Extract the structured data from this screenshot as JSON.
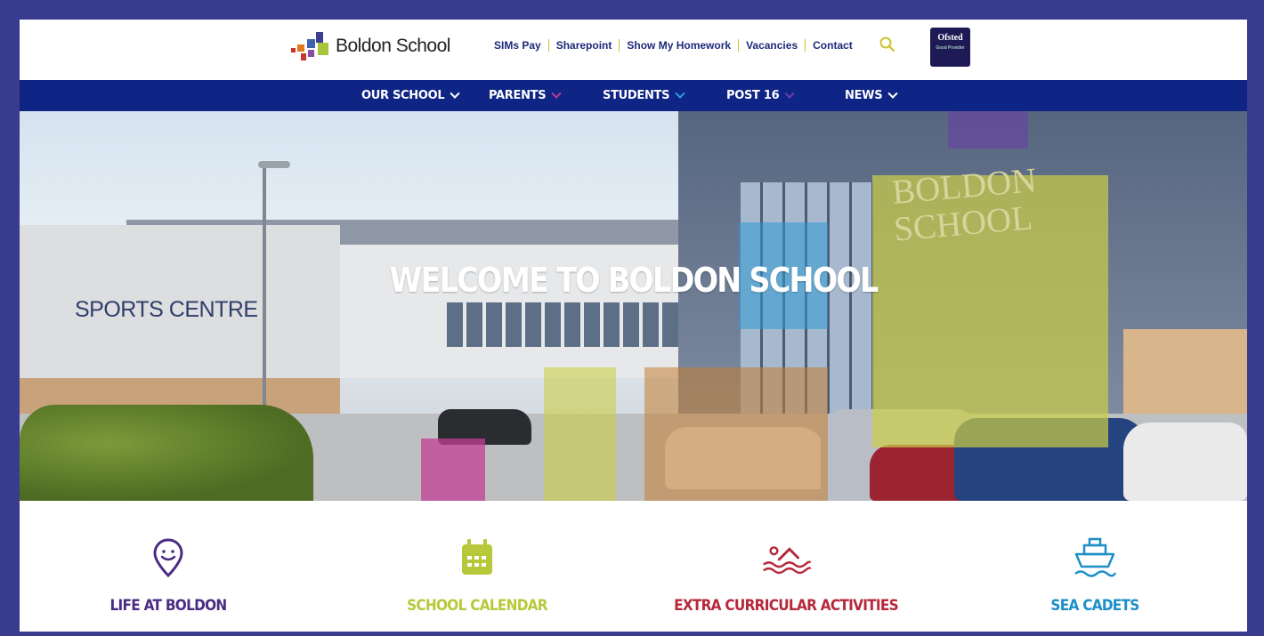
{
  "header": {
    "logo_text": "Boldon School",
    "links": [
      {
        "label": "SIMs Pay"
      },
      {
        "label": "Sharepoint"
      },
      {
        "label": "Show My Homework"
      },
      {
        "label": "Vacancies"
      },
      {
        "label": "Contact"
      }
    ],
    "search_icon": "search-icon",
    "ofsted_badge": {
      "title": "Ofsted",
      "rating": "Good Provider"
    }
  },
  "nav": {
    "items": [
      {
        "label": "OUR SCHOOL",
        "chevron_color": "#ffffff"
      },
      {
        "label": "PARENTS",
        "chevron_color": "#ba3b8f"
      },
      {
        "label": "STUDENTS",
        "chevron_color": "#2e9bd6"
      },
      {
        "label": "POST 16",
        "chevron_color": "#6a3fa6"
      },
      {
        "label": "NEWS",
        "chevron_color": "#ffffff"
      }
    ]
  },
  "hero": {
    "title": "WELCOME TO BOLDON SCHOOL",
    "sign_left": "SPORTS CENTRE",
    "sign_right_line1": "BOLDON",
    "sign_right_line2": "SCHOOL"
  },
  "quick_links": [
    {
      "label": "LIFE AT BOLDON",
      "icon": "map-pin-smile-icon",
      "color": "#4a2c83"
    },
    {
      "label": "SCHOOL CALENDAR",
      "icon": "calendar-icon",
      "color": "#b7c93a"
    },
    {
      "label": "EXTRA CURRICULAR ACTIVITIES",
      "icon": "swimmer-icon",
      "color": "#b5283a"
    },
    {
      "label": "SEA CADETS",
      "icon": "ship-icon",
      "color": "#1c8fc8"
    }
  ],
  "colors": {
    "frame": "#393b8e",
    "nav_bg": "#0e2586",
    "link_sep": "#c9c52e",
    "search": "#c9c52e"
  }
}
